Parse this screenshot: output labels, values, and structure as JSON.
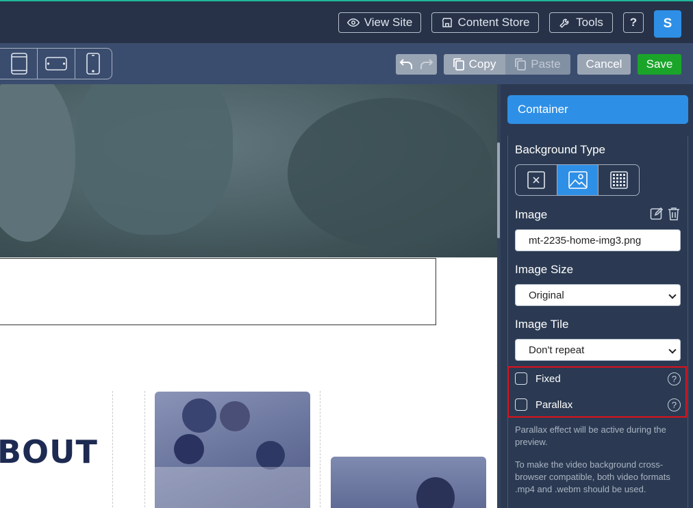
{
  "topbar": {
    "view_site": "View Site",
    "content_store": "Content Store",
    "tools": "Tools",
    "help": "?",
    "avatar_initial": "S"
  },
  "toolbar": {
    "devices": [
      "tablet-portrait",
      "tablet-landscape",
      "mobile"
    ],
    "copy": "Copy",
    "paste": "Paste",
    "cancel": "Cancel",
    "save": "Save"
  },
  "canvas": {
    "heading": "BOUT"
  },
  "panel": {
    "title": "Container",
    "background_type_label": "Background Type",
    "background_types": [
      "none",
      "image",
      "pattern"
    ],
    "background_type_selected": "image",
    "image_label": "Image",
    "image_value": "mt-2235-home-img3.png",
    "image_size_label": "Image Size",
    "image_size_value": "Original",
    "image_tile_label": "Image Tile",
    "image_tile_value": "Don't repeat",
    "fixed_label": "Fixed",
    "parallax_label": "Parallax",
    "parallax_note": "Parallax effect will be active during the preview.",
    "video_note": "To make the video background cross-browser compatible, both video formats .mp4 and .webm should be used."
  },
  "colors": {
    "accent": "#2e8fe6",
    "save": "#1aa52a",
    "highlight": "#e0101c",
    "panel_bg": "#2b3a52"
  }
}
